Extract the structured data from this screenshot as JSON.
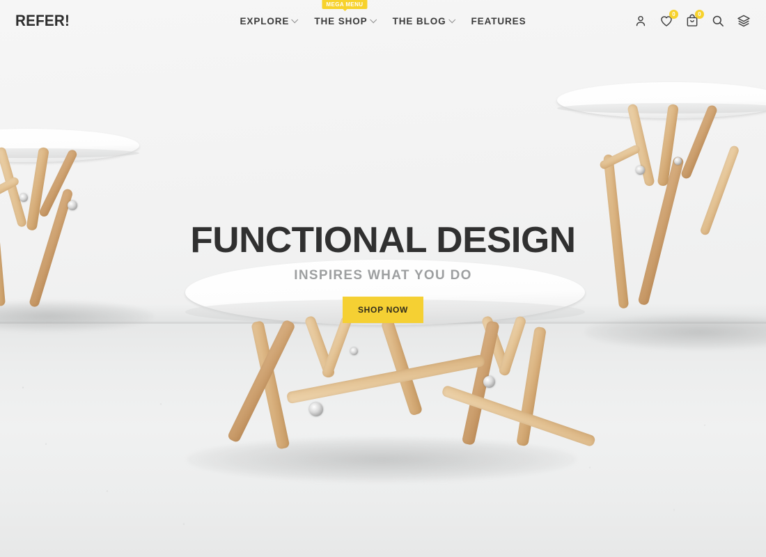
{
  "header": {
    "logo": "REFER!",
    "nav": [
      {
        "label": "EXPLORE",
        "has_chevron": true,
        "badge": null
      },
      {
        "label": "THE SHOP",
        "has_chevron": true,
        "badge": "MEGA MENU"
      },
      {
        "label": "THE BLOG",
        "has_chevron": true,
        "badge": null
      },
      {
        "label": "FEATURES",
        "has_chevron": false,
        "badge": null
      }
    ],
    "icons": [
      {
        "name": "account-icon",
        "count": null
      },
      {
        "name": "wishlist-heart-icon",
        "count": "0"
      },
      {
        "name": "cart-bag-icon",
        "count": "0"
      },
      {
        "name": "search-icon",
        "count": null
      },
      {
        "name": "layers-icon",
        "count": null
      }
    ]
  },
  "hero": {
    "title": "FUNCTIONAL DESIGN",
    "subtitle": "INSPIRES WHAT YOU DO",
    "cta_label": "SHOP NOW"
  },
  "colors": {
    "accent_yellow": "#f5d033",
    "badge_yellow": "#f7d22c",
    "heading_dark": "#303030",
    "subtitle_gray": "#9d9fa0",
    "nav_text": "#3a3a3a",
    "wall": "#f4f4f4",
    "floor": "#ececed",
    "wood": "#dfbb8a",
    "table_top_white": "#ffffff"
  },
  "scene": {
    "description": "Showroom photo: three white round-top wooden tripod tables on a pale concrete floor against a white wall",
    "tables": [
      "left-side-table-cropped",
      "center-coffee-table",
      "right-side-table-cropped"
    ]
  }
}
